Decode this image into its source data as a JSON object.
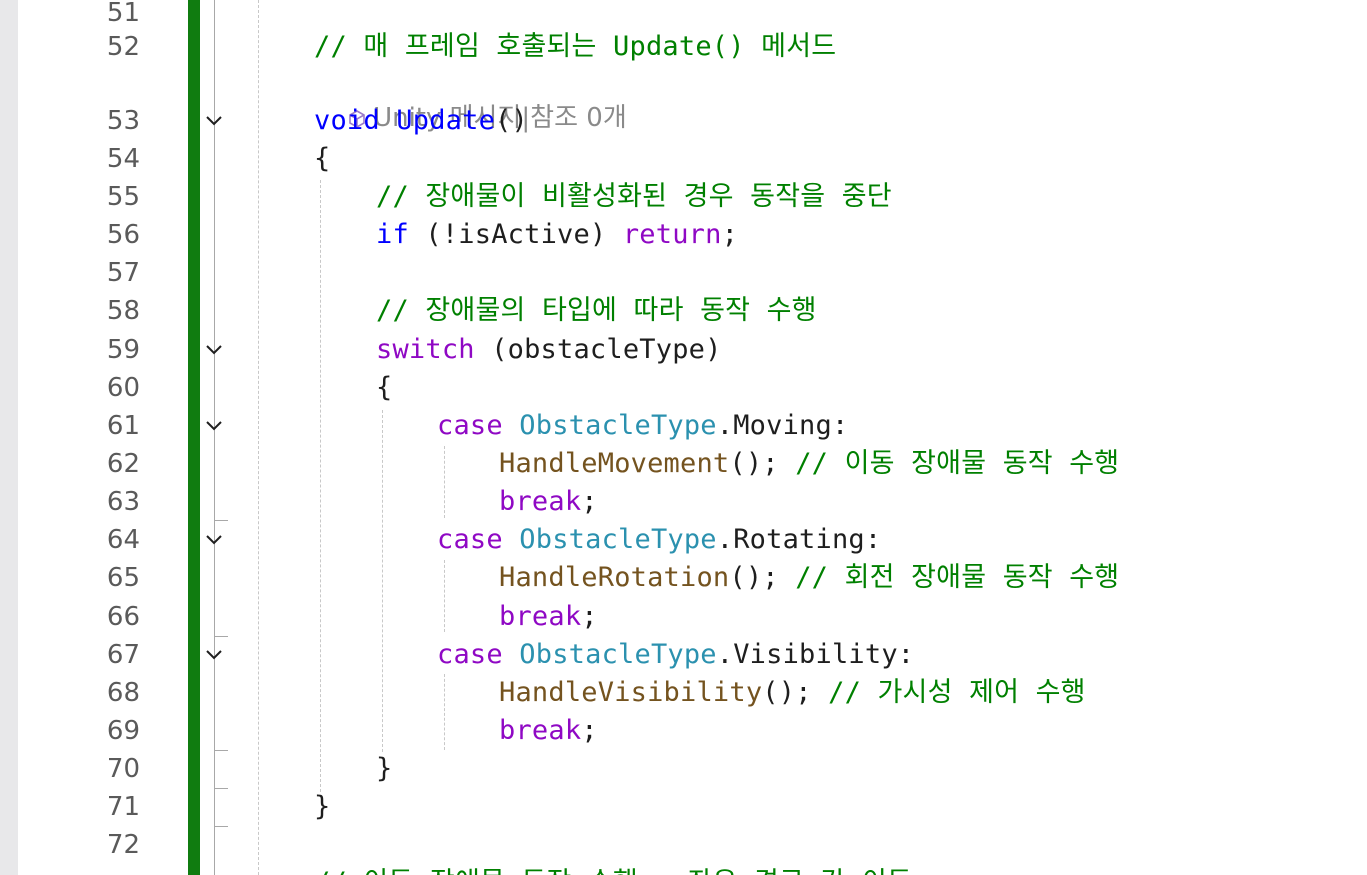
{
  "editor": {
    "lines": [
      {
        "num": "51",
        "tokens": []
      },
      {
        "num": "52",
        "tokens": [
          {
            "t": "// 매 프레임 호출되는 Update() 메서드",
            "c": "cmt"
          }
        ]
      },
      {
        "num": "53",
        "tokens": [
          {
            "t": "void",
            "c": "kw"
          },
          {
            "t": " ",
            "c": "plain"
          },
          {
            "t": "Update",
            "c": "kw"
          },
          {
            "t": "()",
            "c": "plain"
          }
        ]
      },
      {
        "num": "54",
        "tokens": [
          {
            "t": "{",
            "c": "plain"
          }
        ]
      },
      {
        "num": "55",
        "tokens": [
          {
            "t": "// 장애물이 비활성화된 경우 동작을 중단",
            "c": "cmt"
          }
        ]
      },
      {
        "num": "56",
        "tokens": [
          {
            "t": "if",
            "c": "kw"
          },
          {
            "t": " (!isActive) ",
            "c": "plain"
          },
          {
            "t": "return",
            "c": "ctl"
          },
          {
            "t": ";",
            "c": "plain"
          }
        ]
      },
      {
        "num": "57",
        "tokens": []
      },
      {
        "num": "58",
        "tokens": [
          {
            "t": "// 장애물의 타입에 따라 동작 수행",
            "c": "cmt"
          }
        ]
      },
      {
        "num": "59",
        "tokens": [
          {
            "t": "switch",
            "c": "ctl"
          },
          {
            "t": " (obstacleType)",
            "c": "plain"
          }
        ]
      },
      {
        "num": "60",
        "tokens": [
          {
            "t": "{",
            "c": "plain"
          }
        ]
      },
      {
        "num": "61",
        "tokens": [
          {
            "t": "case",
            "c": "ctl"
          },
          {
            "t": " ",
            "c": "plain"
          },
          {
            "t": "ObstacleType",
            "c": "typ"
          },
          {
            "t": ".Moving:",
            "c": "plain"
          }
        ]
      },
      {
        "num": "62",
        "tokens": [
          {
            "t": "HandleMovement",
            "c": "mth"
          },
          {
            "t": "(); ",
            "c": "plain"
          },
          {
            "t": "// 이동 장애물 동작 수행",
            "c": "cmt"
          }
        ]
      },
      {
        "num": "63",
        "tokens": [
          {
            "t": "break",
            "c": "ctl"
          },
          {
            "t": ";",
            "c": "plain"
          }
        ]
      },
      {
        "num": "64",
        "tokens": [
          {
            "t": "case",
            "c": "ctl"
          },
          {
            "t": " ",
            "c": "plain"
          },
          {
            "t": "ObstacleType",
            "c": "typ"
          },
          {
            "t": ".Rotating:",
            "c": "plain"
          }
        ]
      },
      {
        "num": "65",
        "tokens": [
          {
            "t": "HandleRotation",
            "c": "mth"
          },
          {
            "t": "(); ",
            "c": "plain"
          },
          {
            "t": "// 회전 장애물 동작 수행",
            "c": "cmt"
          }
        ]
      },
      {
        "num": "66",
        "tokens": [
          {
            "t": "break",
            "c": "ctl"
          },
          {
            "t": ";",
            "c": "plain"
          }
        ]
      },
      {
        "num": "67",
        "tokens": [
          {
            "t": "case",
            "c": "ctl"
          },
          {
            "t": " ",
            "c": "plain"
          },
          {
            "t": "ObstacleType",
            "c": "typ"
          },
          {
            "t": ".Visibility:",
            "c": "plain"
          }
        ]
      },
      {
        "num": "68",
        "tokens": [
          {
            "t": "HandleVisibility",
            "c": "mth"
          },
          {
            "t": "(); ",
            "c": "plain"
          },
          {
            "t": "// 가시성 제어 수행",
            "c": "cmt"
          }
        ]
      },
      {
        "num": "69",
        "tokens": [
          {
            "t": "break",
            "c": "ctl"
          },
          {
            "t": ";",
            "c": "plain"
          }
        ]
      },
      {
        "num": "70",
        "tokens": [
          {
            "t": "}",
            "c": "plain"
          }
        ]
      },
      {
        "num": "71",
        "tokens": [
          {
            "t": "}",
            "c": "plain"
          }
        ]
      },
      {
        "num": "72",
        "tokens": []
      },
      {
        "num": "",
        "tokens": [
          {
            "t": "// 이동 장애물 동작 수행 - 좌우 경로 간 이동",
            "c": "cmt"
          }
        ]
      }
    ],
    "codelens": {
      "unity_message": "Unity 메시지",
      "separator": "|",
      "references": "참조 0개"
    },
    "colors": {
      "keyword": "#0000ff",
      "control_keyword": "#8f08c4",
      "type": "#2b91af",
      "method": "#74531f",
      "comment": "#008000",
      "change_bar": "#107c10",
      "line_number": "#5a5a5a"
    },
    "icons": {
      "fold": "chevron-down-icon",
      "codelens": "unity-cube-icon"
    }
  }
}
